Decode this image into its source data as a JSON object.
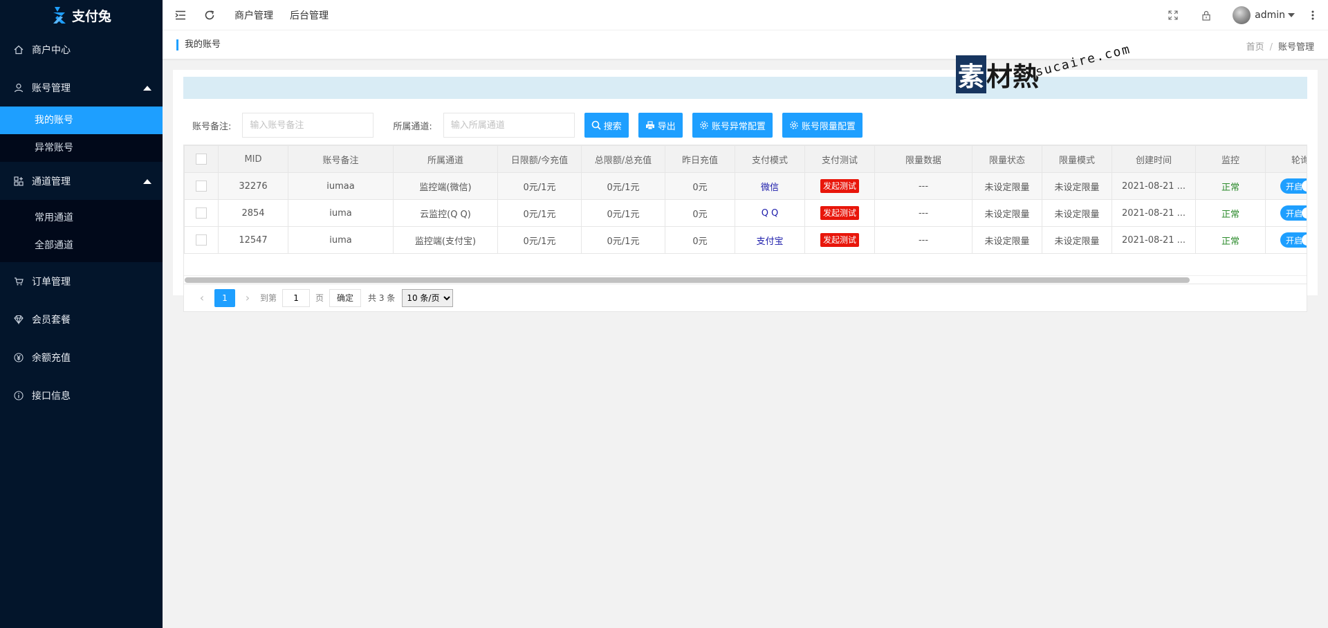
{
  "app": {
    "logo_text": "支付兔"
  },
  "sidebar": {
    "items": [
      {
        "label": "商户中心",
        "icon": "home-icon"
      },
      {
        "label": "账号管理",
        "icon": "user-icon",
        "children": [
          "我的账号",
          "异常账号"
        ]
      },
      {
        "label": "通道管理",
        "icon": "apps-icon",
        "children": [
          "常用通道",
          "全部通道"
        ]
      },
      {
        "label": "订单管理",
        "icon": "cart-icon"
      },
      {
        "label": "会员套餐",
        "icon": "diamond-icon"
      },
      {
        "label": "余额充值",
        "icon": "yen-icon"
      },
      {
        "label": "接口信息",
        "icon": "info-icon"
      }
    ],
    "active_child": "我的账号"
  },
  "header": {
    "links": [
      "商户管理",
      "后台管理"
    ],
    "user": "admin"
  },
  "breadcrumb": {
    "title": "我的账号",
    "home": "首页",
    "sep": "/",
    "current": "账号管理"
  },
  "watermark": {
    "cn_first": "素",
    "cn_rest": "材熱",
    "en": "sucaire.com"
  },
  "filters": {
    "remark_label": "账号备注:",
    "remark_placeholder": "输入账号备注",
    "channel_label": "所属通道:",
    "channel_placeholder": "输入所属通道",
    "buttons": [
      "搜索",
      "导出",
      "账号异常配置",
      "账号限量配置"
    ]
  },
  "table": {
    "columns": [
      "MID",
      "账号备注",
      "所属通道",
      "日限额/今充值",
      "总限额/总充值",
      "昨日充值",
      "支付模式",
      "支付测试",
      "限量数据",
      "限量状态",
      "限量模式",
      "创建时间",
      "监控",
      "轮询"
    ],
    "rows": [
      {
        "mid": "32276",
        "remark": "iumaa",
        "channel": "监控端(微信)",
        "daily": "0元/1元",
        "total": "0元/1元",
        "yesterday": "0元",
        "mode": "微信",
        "test": "发起测试",
        "limit_data": "---",
        "limit_status": "未设定限量",
        "limit_mode": "未设定限量",
        "created": "2021-08-21 ...",
        "monitor": "正常",
        "poll": "开启"
      },
      {
        "mid": "2854",
        "remark": "iuma",
        "channel": "云监控(Q Q)",
        "daily": "0元/1元",
        "total": "0元/1元",
        "yesterday": "0元",
        "mode": "Q Q",
        "test": "发起测试",
        "limit_data": "---",
        "limit_status": "未设定限量",
        "limit_mode": "未设定限量",
        "created": "2021-08-21 ...",
        "monitor": "正常",
        "poll": "开启"
      },
      {
        "mid": "12547",
        "remark": "iuma",
        "channel": "监控端(支付宝)",
        "daily": "0元/1元",
        "total": "0元/1元",
        "yesterday": "0元",
        "mode": "支付宝",
        "test": "发起测试",
        "limit_data": "---",
        "limit_status": "未设定限量",
        "limit_mode": "未设定限量",
        "created": "2021-08-21 ...",
        "monitor": "正常",
        "poll": "开启"
      }
    ]
  },
  "pager": {
    "current": "1",
    "goto_label": "到第",
    "page_value": "1",
    "page_unit": "页",
    "confirm": "确定",
    "total": "共 3 条",
    "page_size": "10 条/页"
  },
  "colors": {
    "sidebar_bg": "#03152b",
    "accent": "#1e9fff",
    "danger": "#e8160b",
    "ok": "#2a8a2a"
  }
}
